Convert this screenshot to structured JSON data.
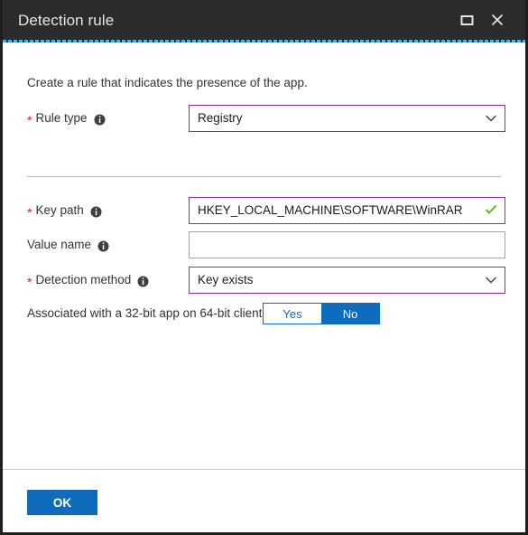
{
  "window": {
    "title": "Detection rule",
    "controls": [
      {
        "name": "maximize",
        "label": "Maximize"
      },
      {
        "name": "close",
        "label": "Close"
      }
    ]
  },
  "content": {
    "intro": "Create a rule that indicates the presence of the app.",
    "fields": {
      "rule_type": {
        "label": "Rule type",
        "required": true,
        "value": "Registry",
        "control": "dropdown",
        "state": "focused"
      },
      "key_path": {
        "label": "Key path",
        "required": true,
        "value": "HKEY_LOCAL_MACHINE\\SOFTWARE\\WinRAR",
        "placeholder": "",
        "control": "textbox",
        "state": "valid"
      },
      "value_name": {
        "label": "Value name",
        "required": false,
        "value": "",
        "placeholder": "",
        "control": "textbox",
        "state": "default"
      },
      "detection_method": {
        "label": "Detection method",
        "required": true,
        "value": "Key exists",
        "control": "dropdown",
        "state": "focused"
      },
      "associated_32bit": {
        "label": "Associated with a 32-bit app on 64-bit clients",
        "required": false,
        "control": "toggle",
        "options": [
          "Yes",
          "No"
        ],
        "selected": "No"
      }
    }
  },
  "footer": {
    "ok_label": "OK"
  },
  "colors": {
    "titlebar_bg": "#2b2b2b",
    "accent_focus_line": "#3bb3ec",
    "field_focus_border": "#8a2d9e",
    "field_border": "#a3a3a3",
    "required_star": "#e81123",
    "primary_button": "#0f6cbd",
    "valid_check": "#5eb715"
  }
}
